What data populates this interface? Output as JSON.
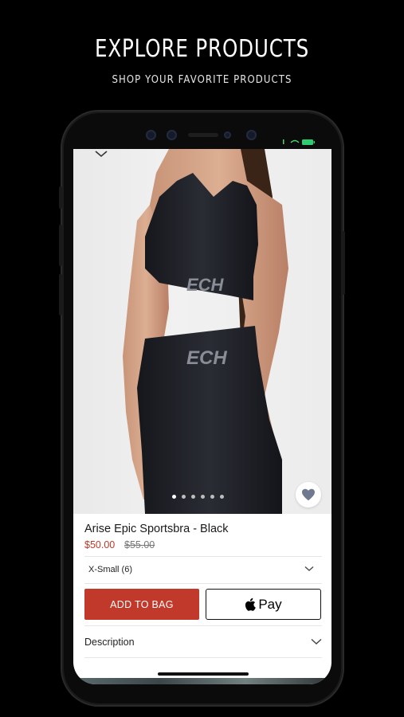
{
  "promo": {
    "headline": "EXPLORE PRODUCTS",
    "subheadline": "SHOP YOUR FAVORITE PRODUCTS"
  },
  "product": {
    "name": "Arise Epic Sportsbra - Black",
    "price": "$50.00",
    "original_price": "$55.00",
    "image_count": 6,
    "active_image_index": 0,
    "brand_text": "ECH"
  },
  "size_select": {
    "selected": "X-Small (6)"
  },
  "actions": {
    "add_to_bag": "ADD TO BAG",
    "apple_pay": "Pay"
  },
  "sections": {
    "description": "Description"
  },
  "colors": {
    "accent": "#c0392b",
    "background": "#000000",
    "battery": "#2ecc71"
  },
  "icons": {
    "favorite": "heart-icon",
    "collapse": "chevron-down-icon",
    "apple": "apple-icon"
  }
}
